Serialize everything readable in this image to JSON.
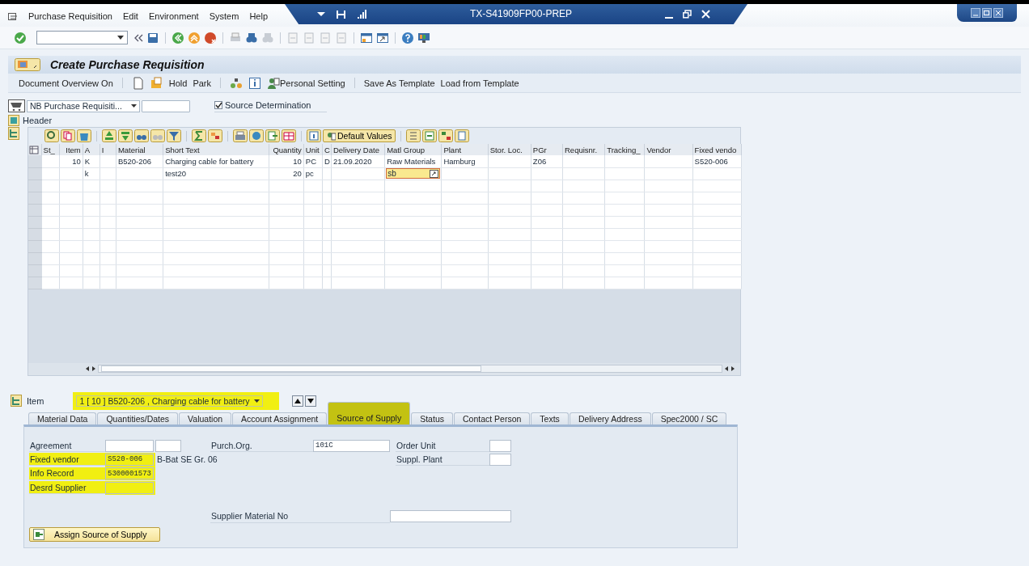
{
  "menu_bar": {
    "items": [
      "Purchase Requisition",
      "Edit",
      "Environment",
      "System",
      "Help"
    ]
  },
  "window": {
    "title": "TX-S41909FP00-PREP"
  },
  "screen_title": "Create Purchase Requisition",
  "app_toolbar": {
    "items": [
      "Document Overview On",
      "Hold",
      "Park",
      "Personal Setting",
      "Save As Template",
      "Load from Template"
    ]
  },
  "header_area": {
    "document_type": "NB Purchase Requisiti...",
    "source_determination": {
      "label": "Source Determination",
      "checked": true
    },
    "header_label": "Header"
  },
  "grid_toolbar": {
    "button": "Default Values"
  },
  "table": {
    "columns": [
      {
        "label": "St_"
      },
      {
        "label": "Item",
        "kind": "number"
      },
      {
        "label": "A"
      },
      {
        "label": "I"
      },
      {
        "label": "Material"
      },
      {
        "label": "Short Text"
      },
      {
        "label": "Quantity",
        "kind": "number"
      },
      {
        "label": "Unit"
      },
      {
        "label": "C"
      },
      {
        "label": "Delivery Date"
      },
      {
        "label": "Matl Group"
      },
      {
        "label": "Plant"
      },
      {
        "label": "Stor. Loc."
      },
      {
        "label": "PGr"
      },
      {
        "label": "Requisnr."
      },
      {
        "label": "Tracking_"
      },
      {
        "label": "Vendor"
      },
      {
        "label": "Fixed vendo"
      }
    ],
    "rows": [
      {
        "cells": [
          null,
          "10",
          "K",
          null,
          "B520-206",
          "Charging cable for battery",
          "10",
          "PC",
          "D",
          "21.09.2020",
          "Raw Materials",
          "Hamburg",
          null,
          "Z06",
          null,
          null,
          null,
          "S520-006"
        ]
      },
      {
        "cells": [
          null,
          null,
          "k",
          null,
          null,
          "test20",
          "20",
          "pc",
          null,
          null,
          {
            "value": "sb",
            "editing": true
          },
          null,
          null,
          null,
          null,
          null,
          null,
          null
        ]
      }
    ]
  },
  "item_selector": {
    "label": "Item",
    "value": "1 [ 10 ] B520-206 , Charging cable for battery",
    "highlighted": true
  },
  "tabs": [
    {
      "label": "Material Data",
      "selected": false,
      "highlighted": false
    },
    {
      "label": "Quantities/Dates",
      "selected": false,
      "highlighted": false
    },
    {
      "label": "Valuation",
      "selected": false,
      "highlighted": false
    },
    {
      "label": "Account Assignment",
      "selected": false,
      "highlighted": false
    },
    {
      "label": "Source of Supply",
      "selected": true,
      "highlighted": true
    },
    {
      "label": "Status",
      "selected": false,
      "highlighted": false
    },
    {
      "label": "Contact Person",
      "selected": false,
      "highlighted": false
    },
    {
      "label": "Texts",
      "selected": false,
      "highlighted": false
    },
    {
      "label": "Delivery Address",
      "selected": false,
      "highlighted": false
    },
    {
      "label": "Spec2000 / SC",
      "selected": false,
      "highlighted": false
    }
  ],
  "fields": [
    {
      "label": "Agreement",
      "kind": "double",
      "highlighted": false
    },
    {
      "label": "Purch.Org.",
      "value": "101C",
      "kind": "single",
      "highlighted": false
    },
    {
      "label": "Order Unit",
      "kind": "single",
      "highlighted": false
    },
    {
      "label": "Fixed vendor",
      "value": "S520-006",
      "description": "B-Bat SE Gr. 06",
      "kind": "with-text",
      "highlighted": true
    },
    {
      "label": "Suppl. Plant",
      "kind": "single",
      "highlighted": false
    },
    {
      "label": "Info Record",
      "value": "5300001573",
      "kind": "single",
      "highlighted": true
    },
    {
      "label": "Desrd Supplier",
      "kind": "single",
      "highlighted": true
    },
    {
      "label": "Supplier Material No",
      "kind": "single",
      "highlighted": false
    }
  ],
  "assign_button": "Assign Source of Supply"
}
